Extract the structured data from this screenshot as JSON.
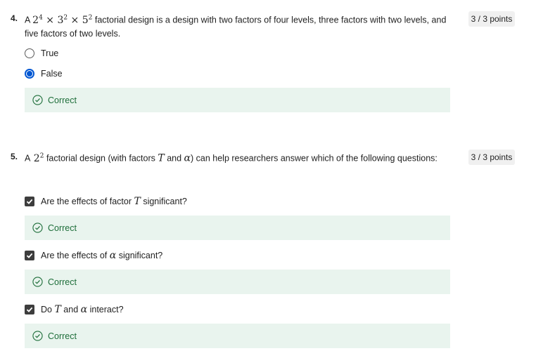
{
  "q4": {
    "number": "4.",
    "text_pre": "A",
    "math": {
      "b1": "2",
      "e1": "4",
      "op1": "×",
      "b2": "3",
      "e2": "2",
      "op2": "×",
      "b3": "5",
      "e3": "2"
    },
    "text_post": "factorial design is a design with two factors of four levels, three factors with two levels, and five factors of two levels.",
    "points": "3 / 3 points",
    "options": [
      {
        "label": "True",
        "selected": false
      },
      {
        "label": "False",
        "selected": true
      }
    ],
    "feedback": "Correct"
  },
  "q5": {
    "number": "5.",
    "text_pre": "A",
    "math": {
      "base": "2",
      "exp": "2"
    },
    "text_mid1": "factorial design (with factors",
    "var_t": "T",
    "text_mid2": "and",
    "var_a": "α",
    "text_post": ") can help researchers answer which of the following questions:",
    "points": "3 / 3 points",
    "options": [
      {
        "pre": "Are the effects of factor",
        "var": "T",
        "post": "significant?",
        "checked": true,
        "feedback": "Correct"
      },
      {
        "pre": "Are the effects of",
        "var": "α",
        "post": "significant?",
        "checked": true,
        "feedback": "Correct"
      },
      {
        "pre": "Do",
        "var": "T",
        "mid": "and",
        "var2": "α",
        "post": "interact?",
        "checked": true,
        "feedback": "Correct"
      }
    ]
  },
  "colors": {
    "accent": "#0056d2",
    "correct_text": "#1e6e3a",
    "correct_bg": "#e9f4ee",
    "checkbox": "#3d3d3d"
  }
}
